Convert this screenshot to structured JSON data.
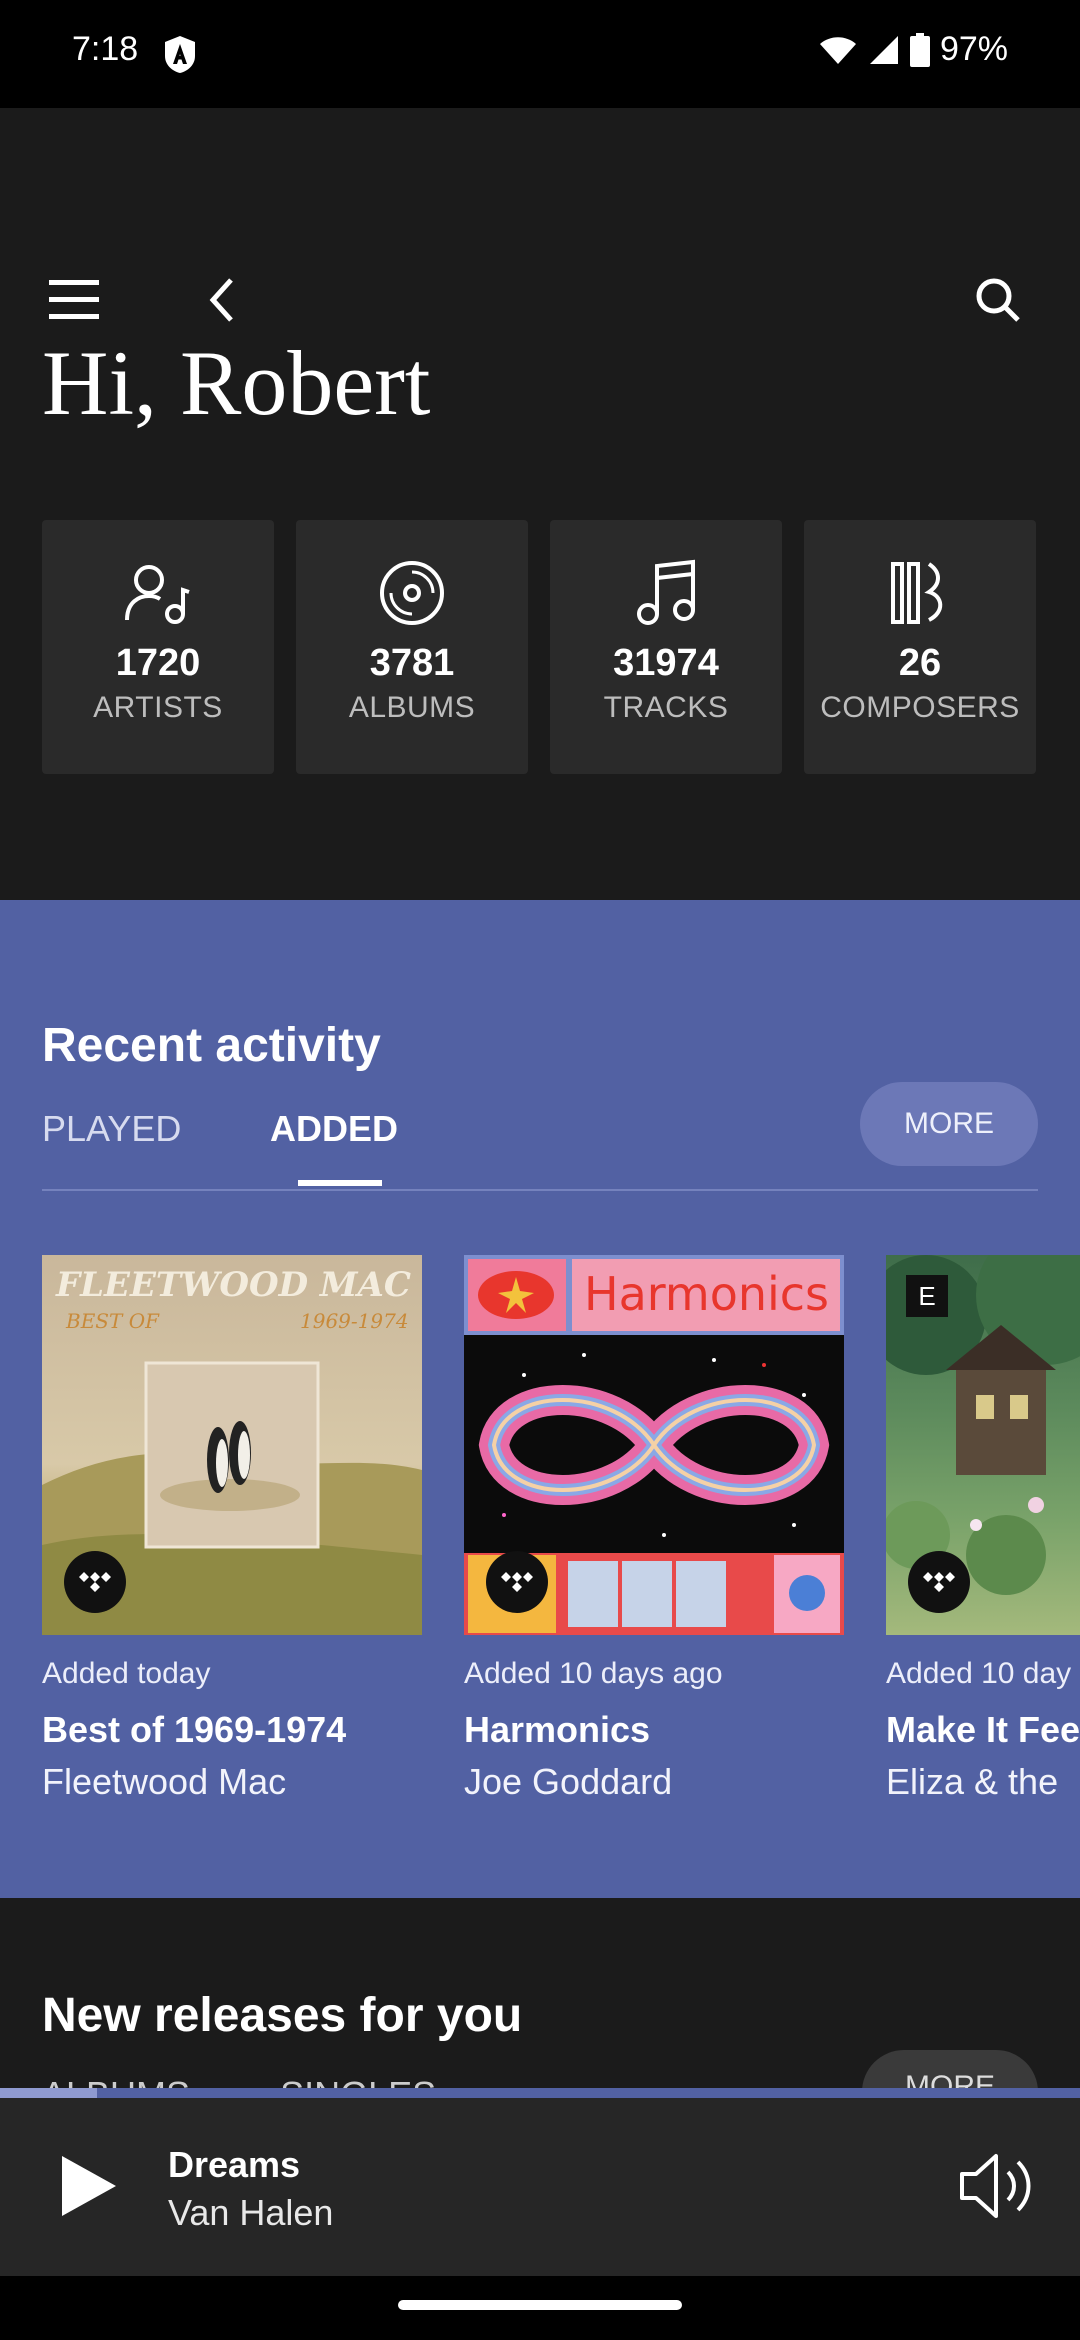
{
  "status_bar": {
    "time": "7:18",
    "battery": "97%"
  },
  "header": {
    "menu_icon": "hamburger-menu-icon",
    "back_icon": "chevron-left-icon",
    "search_icon": "search-icon",
    "greeting": "Hi, Robert"
  },
  "stats": [
    {
      "icon": "artist-icon",
      "count": "1720",
      "label": "ARTISTS"
    },
    {
      "icon": "album-icon",
      "count": "3781",
      "label": "ALBUMS"
    },
    {
      "icon": "music-note-icon",
      "count": "31974",
      "label": "TRACKS"
    },
    {
      "icon": "composer-icon",
      "count": "26",
      "label": "COMPOSERS"
    }
  ],
  "recent_activity": {
    "title": "Recent activity",
    "tabs": [
      "PLAYED",
      "ADDED"
    ],
    "active_tab": "ADDED",
    "more_label": "MORE",
    "items": [
      {
        "added": "Added today",
        "title": "Best of 1969-1974",
        "artist": "Fleetwood Mac",
        "cover_text_1": "FLEETWOOD MAC",
        "cover_text_2": "BEST OF",
        "cover_text_3": "1969-1974"
      },
      {
        "added": "Added 10 days ago",
        "title": "Harmonics",
        "artist": "Joe Goddard",
        "cover_text_1": "Harmonics"
      },
      {
        "added": "Added 10 day",
        "title": "Make It Fee",
        "artist": "Eliza & the",
        "explicit": "E"
      }
    ]
  },
  "new_releases": {
    "title": "New releases for you",
    "tabs": [
      "ALBUMS",
      "SINGLES"
    ],
    "more_label": "MORE"
  },
  "player": {
    "title": "Dreams",
    "artist": "Van Halen",
    "progress": 0.09
  },
  "colors": {
    "background": "#1b1b1b",
    "accent": "#5261a3",
    "card": "#2a2a2a"
  }
}
